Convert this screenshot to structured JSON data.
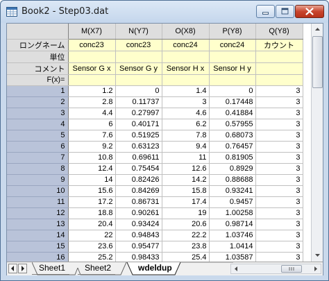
{
  "window": {
    "title": "Book2 - Step03.dat",
    "buttons": {
      "minimize": "minimize",
      "maximize": "maximize",
      "close": "close"
    }
  },
  "sheet": {
    "columns": [
      "M(X7)",
      "N(Y7)",
      "O(X8)",
      "P(Y8)",
      "Q(Y8)"
    ],
    "meta_rows": [
      {
        "label": "ロングネーム",
        "values": [
          "conc23",
          "conc23",
          "conc24",
          "conc24",
          "カウント"
        ]
      },
      {
        "label": "単位",
        "values": [
          "",
          "",
          "",
          "",
          ""
        ]
      },
      {
        "label": "コメント",
        "values": [
          "Sensor G x",
          "Sensor G y",
          "Sensor H x",
          "Sensor H y",
          ""
        ]
      },
      {
        "label": "F(x)=",
        "values": [
          "",
          "",
          "",
          "",
          ""
        ]
      }
    ],
    "rows": [
      {
        "n": "1",
        "cells": [
          "1.2",
          "0",
          "1.4",
          "0",
          "3"
        ]
      },
      {
        "n": "2",
        "cells": [
          "2.8",
          "0.11737",
          "3",
          "0.17448",
          "3"
        ]
      },
      {
        "n": "3",
        "cells": [
          "4.4",
          "0.27997",
          "4.6",
          "0.41884",
          "3"
        ]
      },
      {
        "n": "4",
        "cells": [
          "6",
          "0.40171",
          "6.2",
          "0.57955",
          "3"
        ]
      },
      {
        "n": "5",
        "cells": [
          "7.6",
          "0.51925",
          "7.8",
          "0.68073",
          "3"
        ]
      },
      {
        "n": "6",
        "cells": [
          "9.2",
          "0.63123",
          "9.4",
          "0.76457",
          "3"
        ]
      },
      {
        "n": "7",
        "cells": [
          "10.8",
          "0.69611",
          "11",
          "0.81905",
          "3"
        ]
      },
      {
        "n": "8",
        "cells": [
          "12.4",
          "0.75454",
          "12.6",
          "0.8929",
          "3"
        ]
      },
      {
        "n": "9",
        "cells": [
          "14",
          "0.82426",
          "14.2",
          "0.88688",
          "3"
        ]
      },
      {
        "n": "10",
        "cells": [
          "15.6",
          "0.84269",
          "15.8",
          "0.93241",
          "3"
        ]
      },
      {
        "n": "11",
        "cells": [
          "17.2",
          "0.86731",
          "17.4",
          "0.9457",
          "3"
        ]
      },
      {
        "n": "12",
        "cells": [
          "18.8",
          "0.90261",
          "19",
          "1.00258",
          "3"
        ]
      },
      {
        "n": "13",
        "cells": [
          "20.4",
          "0.93424",
          "20.6",
          "0.98714",
          "3"
        ]
      },
      {
        "n": "14",
        "cells": [
          "22",
          "0.94843",
          "22.2",
          "1.03746",
          "3"
        ]
      },
      {
        "n": "15",
        "cells": [
          "23.6",
          "0.95477",
          "23.8",
          "1.0414",
          "3"
        ]
      },
      {
        "n": "16",
        "cells": [
          "25.2",
          "0.98433",
          "25.4",
          "1.03587",
          "3"
        ]
      }
    ]
  },
  "tabs": [
    {
      "label": "Sheet1",
      "active": false
    },
    {
      "label": "Sheet2",
      "active": false
    },
    {
      "label": "wdeldup",
      "active": true
    }
  ],
  "colors": {
    "meta_bg": "#ffffcc",
    "row_header_bg": "#b9c3d9",
    "header_bg": "#dedede",
    "close_button": "#c8452e"
  }
}
